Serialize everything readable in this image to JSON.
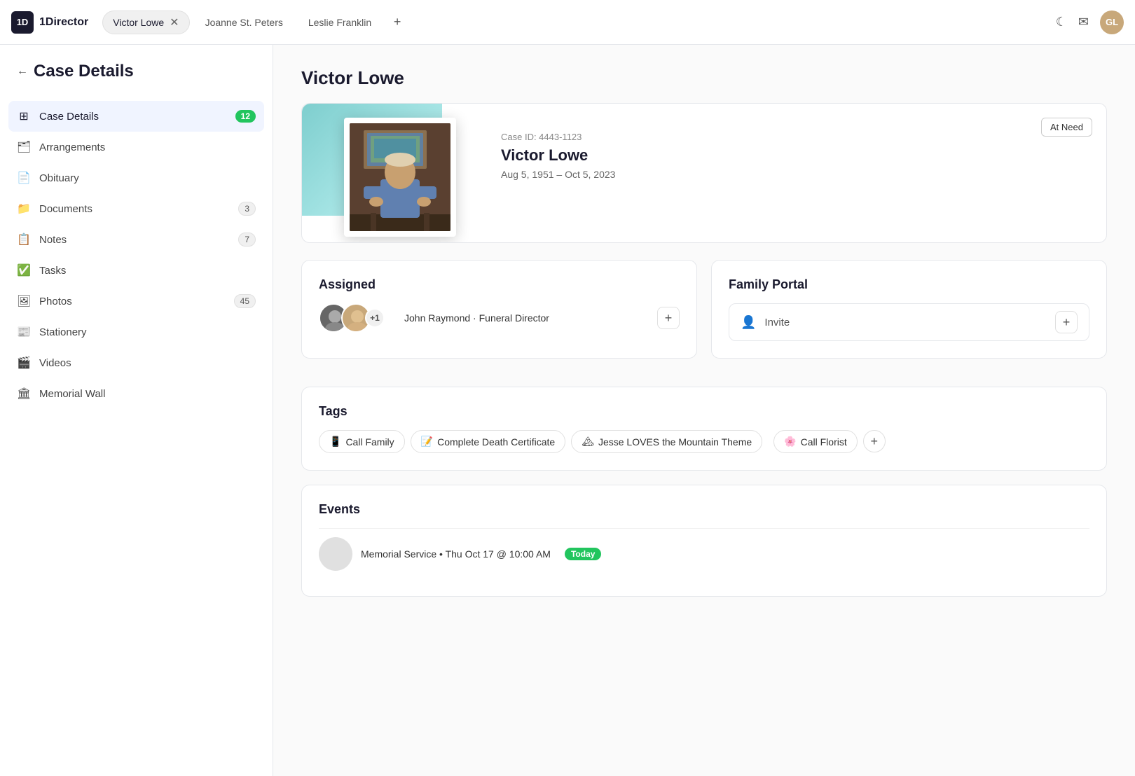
{
  "app": {
    "name": "1Director",
    "logo_letter": "1D"
  },
  "topbar": {
    "tabs": [
      {
        "id": "victor-lowe",
        "label": "Victor Lowe",
        "active": true
      },
      {
        "id": "joanne-st-peters",
        "label": "Joanne St. Peters",
        "active": false
      },
      {
        "id": "leslie-franklin",
        "label": "Leslie Franklin",
        "active": false
      }
    ],
    "add_tab_label": "+",
    "moon_icon": "☾",
    "mail_icon": "✉",
    "avatar_initials": "GL"
  },
  "sidebar": {
    "back_label": "Case Details",
    "nav_items": [
      {
        "id": "case-details",
        "icon": "⊞",
        "label": "Case Details",
        "badge": "12",
        "badge_type": "green",
        "active": true
      },
      {
        "id": "arrangements",
        "icon": "🗂",
        "label": "Arrangements",
        "badge": null,
        "active": false
      },
      {
        "id": "obituary",
        "icon": "📄",
        "label": "Obituary",
        "badge": null,
        "active": false
      },
      {
        "id": "documents",
        "icon": "📁",
        "label": "Documents",
        "badge": "3",
        "badge_type": "gray",
        "active": false
      },
      {
        "id": "notes",
        "icon": "📋",
        "label": "Notes",
        "badge": "7",
        "badge_type": "gray",
        "active": false
      },
      {
        "id": "tasks",
        "icon": "✅",
        "label": "Tasks",
        "badge": null,
        "active": false
      },
      {
        "id": "photos",
        "icon": "🖼",
        "label": "Photos",
        "badge": "45",
        "badge_type": "gray",
        "active": false
      },
      {
        "id": "stationery",
        "icon": "📰",
        "label": "Stationery",
        "badge": null,
        "active": false
      },
      {
        "id": "videos",
        "icon": "🎬",
        "label": "Videos",
        "badge": null,
        "active": false
      },
      {
        "id": "memorial-wall",
        "icon": "🏛",
        "label": "Memorial Wall",
        "badge": null,
        "active": false
      }
    ]
  },
  "main": {
    "page_title": "Victor Lowe",
    "case_card": {
      "at_need_label": "At Need",
      "case_id_label": "Case ID: 4443-1123",
      "name": "Victor Lowe",
      "dates": "Aug 5, 1951 – Oct 5, 2023"
    },
    "assigned_section": {
      "title": "Assigned",
      "person_name": "John Raymond · Funeral Director",
      "plus_count": "+1",
      "add_icon": "+"
    },
    "family_portal_section": {
      "title": "Family Portal",
      "invite_label": "Invite",
      "person_icon": "👤",
      "add_icon": "+"
    },
    "tags_section": {
      "title": "Tags",
      "tags": [
        {
          "id": "call-family",
          "emoji": "📱",
          "label": "Call Family"
        },
        {
          "id": "complete-death-certificate",
          "emoji": "📝",
          "label": "Complete Death Certificate"
        },
        {
          "id": "jesse-loves-mountain",
          "emoji": "🏔",
          "label": "Jesse LOVES the Mountain Theme"
        },
        {
          "id": "call-florist",
          "emoji": "🌸",
          "label": "Call Florist"
        }
      ],
      "add_icon": "+"
    },
    "events_section": {
      "title": "Events",
      "events": [
        {
          "id": "memorial-service",
          "text": "Memorial Service • Thu Oct 17 @ 10:00 AM",
          "today": true,
          "today_label": "Today"
        }
      ]
    }
  }
}
